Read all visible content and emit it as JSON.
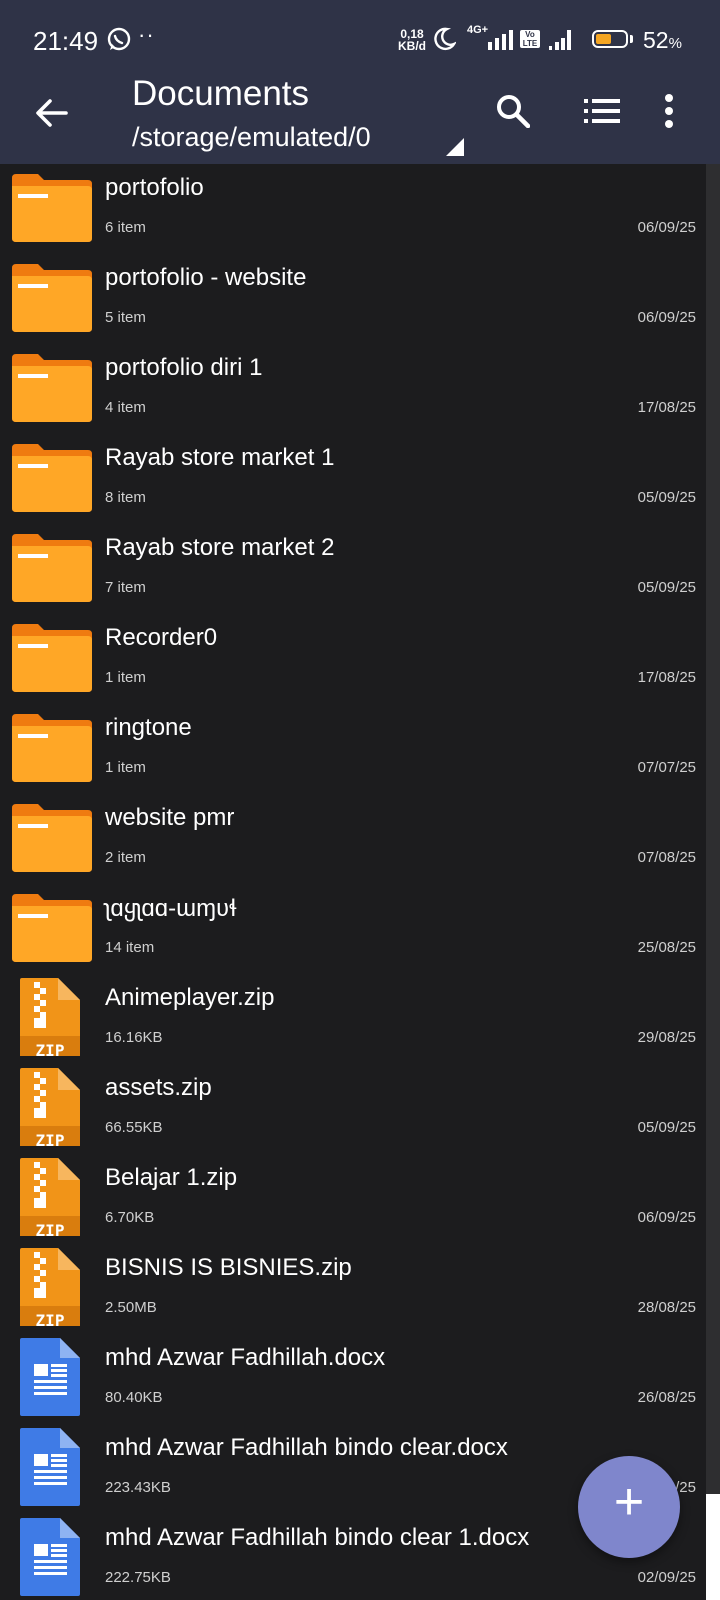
{
  "status_bar": {
    "time": "21:49",
    "dots": "··",
    "net_speed_top": "0,18",
    "net_speed_bottom": "KB/d",
    "network_type": "4G+",
    "volte_top": "Vo",
    "volte_bottom": "LTE",
    "battery_percent": "52",
    "battery_unit": "%",
    "battery_level": 0.52
  },
  "header": {
    "title": "Documents",
    "path": "/storage/emulated/0"
  },
  "files": [
    {
      "type": "folder",
      "name": "portofolio",
      "meta": "6 item",
      "date": "06/09/25"
    },
    {
      "type": "folder",
      "name": "portofolio - website",
      "meta": "5 item",
      "date": "06/09/25"
    },
    {
      "type": "folder",
      "name": "portofolio diri 1",
      "meta": "4 item",
      "date": "17/08/25"
    },
    {
      "type": "folder",
      "name": "Rayab store market 1",
      "meta": "8 item",
      "date": "05/09/25"
    },
    {
      "type": "folder",
      "name": "Rayab store market 2",
      "meta": "7 item",
      "date": "05/09/25"
    },
    {
      "type": "folder",
      "name": "Recorder0",
      "meta": "1 item",
      "date": "17/08/25"
    },
    {
      "type": "folder",
      "name": "ringtone",
      "meta": "1 item",
      "date": "07/07/25"
    },
    {
      "type": "folder",
      "name": "website pmr",
      "meta": "2 item",
      "date": "07/08/25"
    },
    {
      "type": "folder",
      "name": "ʅɑყʅɑɑ-ɯɱʋɬ",
      "meta": "14 item",
      "date": "25/08/25"
    },
    {
      "type": "zip",
      "name": "Animeplayer.zip",
      "meta": "16.16KB",
      "date": "29/08/25"
    },
    {
      "type": "zip",
      "name": "assets.zip",
      "meta": "66.55KB",
      "date": "05/09/25"
    },
    {
      "type": "zip",
      "name": "Belajar 1.zip",
      "meta": "6.70KB",
      "date": "06/09/25"
    },
    {
      "type": "zip",
      "name": "BISNIS IS BISNIES.zip",
      "meta": "2.50MB",
      "date": "28/08/25"
    },
    {
      "type": "docx",
      "name": "mhd Azwar Fadhillah.docx",
      "meta": "80.40KB",
      "date": "26/08/25"
    },
    {
      "type": "docx",
      "name": "mhd Azwar Fadhillah bindo clear.docx",
      "meta": "223.43KB",
      "date": "09/25"
    },
    {
      "type": "docx",
      "name": "mhd Azwar Fadhillah bindo clear 1.docx",
      "meta": "222.75KB",
      "date": "02/09/25"
    }
  ],
  "zip_icon_label": "ZIP",
  "fab": {
    "label": "+"
  },
  "colors": {
    "appbar": "#2f3347",
    "background": "#1c1c1e",
    "folder": "#ffa726",
    "folder_tab": "#ef7b10",
    "zip": "#f19418",
    "docx": "#3f7be6",
    "fab": "#7f86cc"
  }
}
